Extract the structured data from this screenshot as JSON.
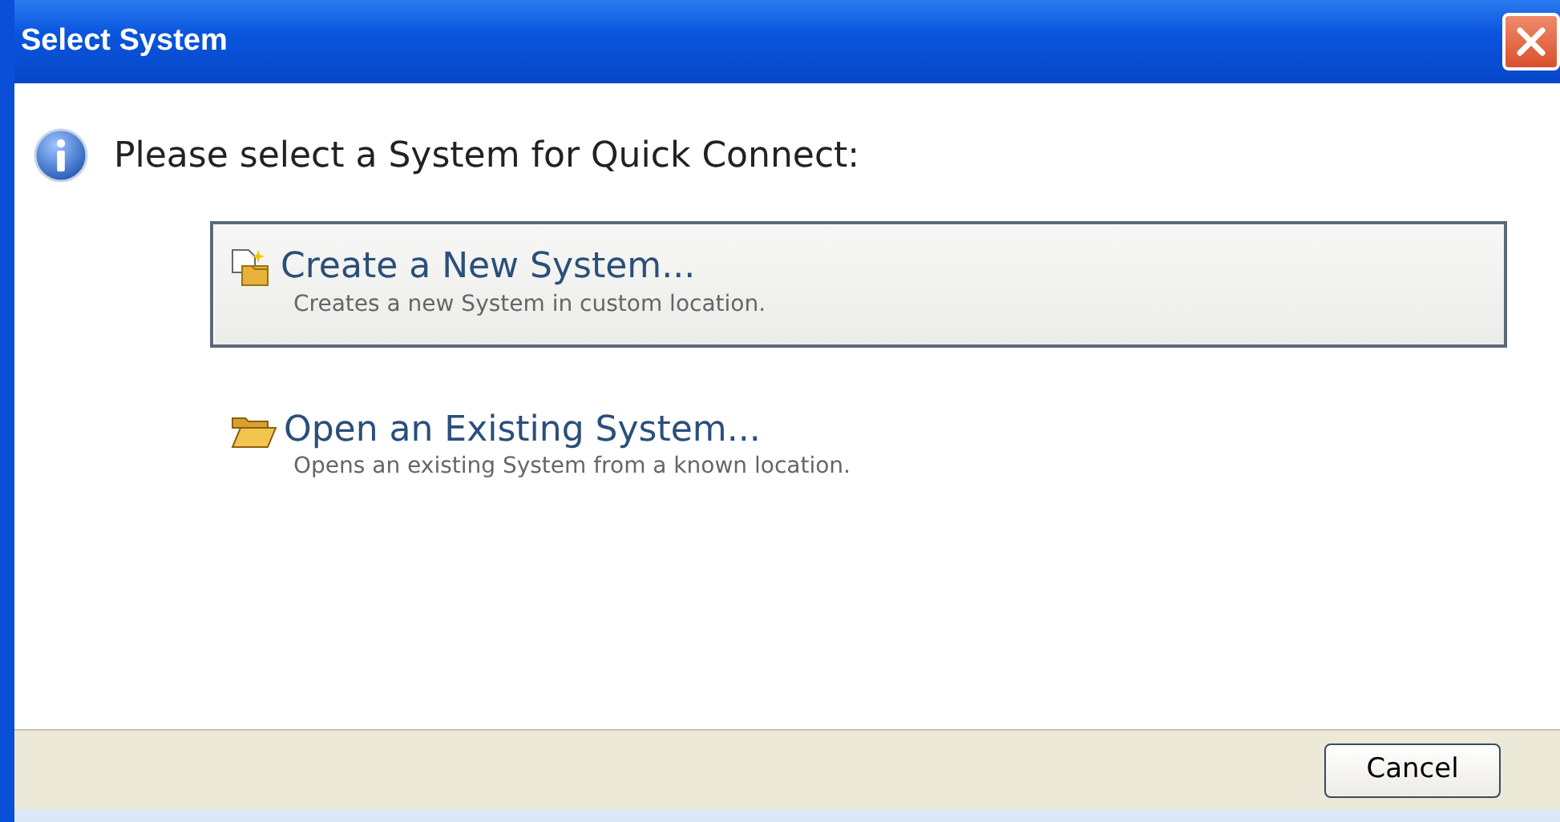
{
  "window": {
    "title": "Select System"
  },
  "message": "Please select a System for Quick Connect:",
  "options": [
    {
      "kind": "new",
      "title": "Create a New System...",
      "description": "Creates a new System in custom location.",
      "selected": true
    },
    {
      "kind": "open",
      "title": "Open an Existing System...",
      "description": "Opens an existing System from a known location.",
      "selected": false
    }
  ],
  "buttons": [
    "Cancel"
  ]
}
